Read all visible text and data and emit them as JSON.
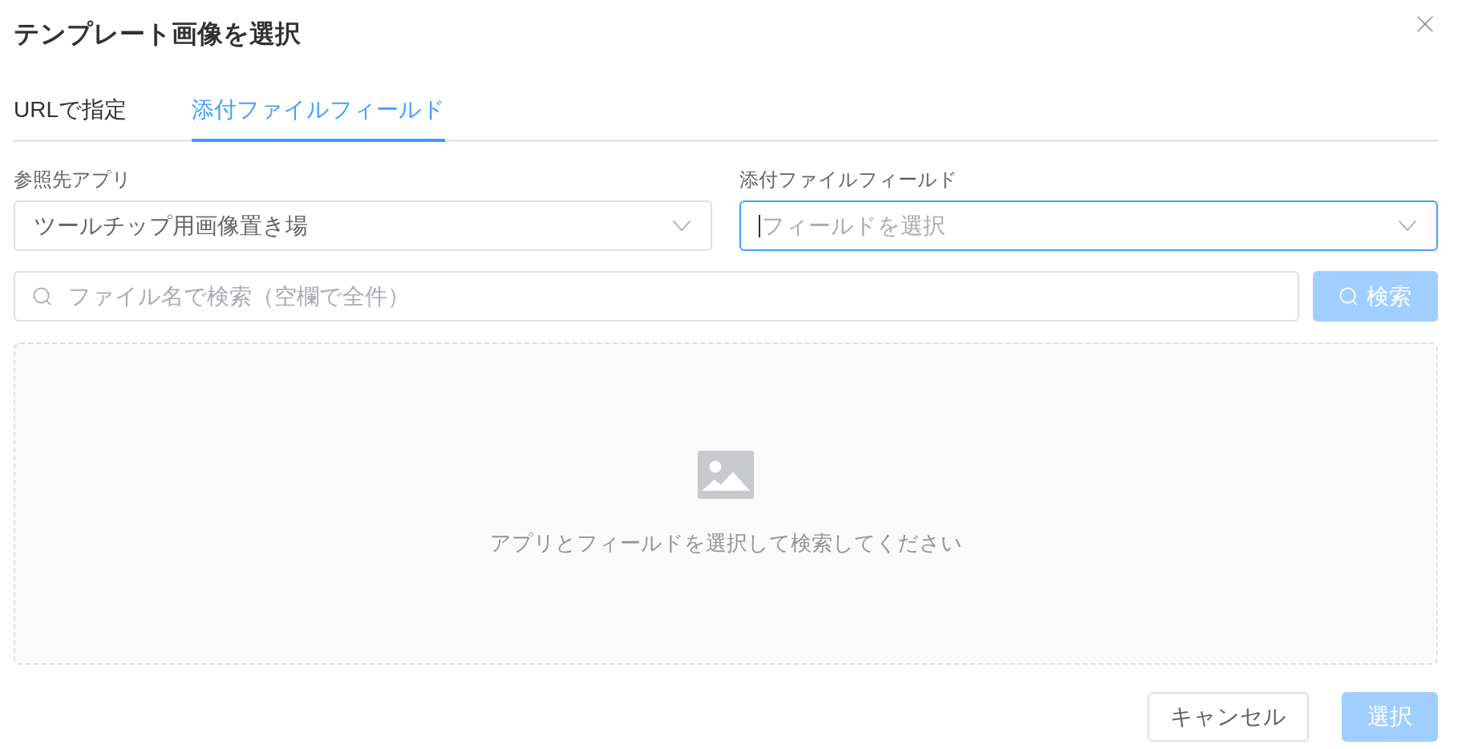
{
  "dialog": {
    "title": "テンプレート画像を選択"
  },
  "tabs": [
    {
      "label": "URLで指定",
      "selected": false
    },
    {
      "label": "添付ファイルフィールド",
      "selected": true
    }
  ],
  "fields": [
    {
      "label": "参照先アプリ",
      "value": "ツールチップ用画像置き場",
      "focused": false
    },
    {
      "label": "添付ファイルフィールド",
      "placeholder": "フィールドを選択",
      "focused": true
    }
  ],
  "search": {
    "placeholder": "ファイル名で検索（空欄で全件）",
    "button": {
      "label": "検索",
      "disabled": true
    }
  },
  "empty_state": {
    "message": "アプリとフィールドを選択して検索してください"
  },
  "footer_buttons": [
    {
      "kind": "secondary",
      "label": "キャンセル",
      "disabled": false
    },
    {
      "kind": "primary",
      "label": "選択",
      "disabled": true
    }
  ]
}
